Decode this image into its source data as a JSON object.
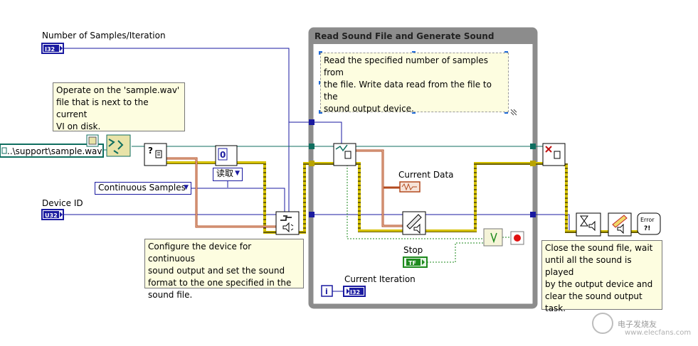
{
  "loop": {
    "title": "Read Sound File and Generate Sound"
  },
  "controls": {
    "samples_label": "Number of Samples/Iteration",
    "samples_type": "I32",
    "device_label": "Device ID",
    "device_type": "U32",
    "path_value": "..\\support\\sample.wav",
    "mode_value": "Continuous Samples",
    "read_ring": "读取",
    "const_zero": "0"
  },
  "indicators": {
    "current_data_label": "Current Data",
    "stop_label": "Stop",
    "stop_value": "TF",
    "iteration_label": "Current Iteration",
    "iteration_type": "I32",
    "iteration_terminal": "i"
  },
  "comments": {
    "file_comment": "Operate on the 'sample.wav'\nfile that is next to the current\nVI on disk.",
    "loop_comment": "Read the specified number of samples from\nthe file. Write data read from the file to the\nsound output device.",
    "configure_comment": "Configure the device for continuous\nsound output and set the sound\nformat to the one specified in the\nsound file.",
    "close_comment": "Close the sound file, wait\nuntil all the sound is played\nby the output device and\nclear the sound output task."
  },
  "subvi_glyphs": {
    "open_file": "?",
    "error_handler": "Error\n?!"
  },
  "colors": {
    "int_wire": "#1a1aa0",
    "error_wire": "#d4c000",
    "refnum_wire": "#0f6e5f",
    "cluster_wire": "#b34a1e",
    "bool_wire": "#1e8a1e",
    "loop_border": "#8c8c8c"
  },
  "watermark": {
    "text": "电子发烧友",
    "url": "www.elecfans.com"
  }
}
